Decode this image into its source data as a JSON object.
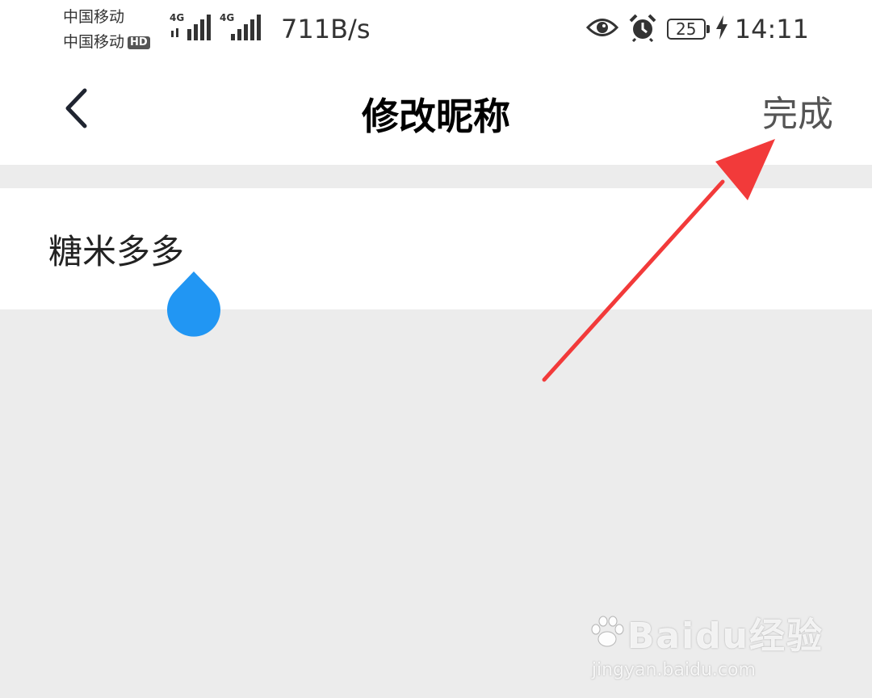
{
  "status_bar": {
    "carrier_1": "中国移动",
    "carrier_2": "中国移动",
    "hd_badge": "HD",
    "network_1": "4G",
    "network_2": "4G",
    "net_speed": "711B/s",
    "battery_level": "25",
    "time": "14:11",
    "icons": [
      "eye-icon",
      "alarm-icon",
      "battery-icon",
      "charging-icon",
      "signal-icon"
    ]
  },
  "nav": {
    "title": "修改昵称",
    "done_label": "完成",
    "back_icon": "chevron-left-icon"
  },
  "nickname": {
    "value": "糖米多多"
  },
  "colors": {
    "cursor_handle": "#2196f3",
    "annotation_arrow": "#f23a3a",
    "page_background": "#ececec"
  },
  "watermark": {
    "main": "Baidu经验",
    "sub": "jingyan.baidu.com"
  }
}
